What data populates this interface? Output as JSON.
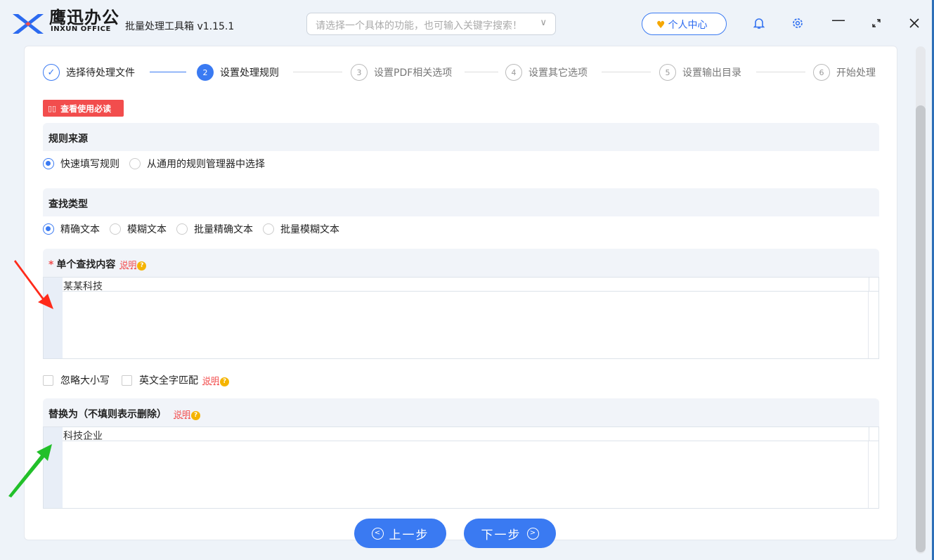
{
  "app": {
    "brand_cn": "鹰迅办公",
    "brand_en": "INXUN OFFICE",
    "title": "批量处理工具箱 v1.15.1"
  },
  "search": {
    "placeholder": "请选择一个具体的功能，也可输入关键字搜索！"
  },
  "header": {
    "personal_center": "个人中心"
  },
  "steps": [
    {
      "num": "✓",
      "label": "选择待处理文件",
      "state": "done"
    },
    {
      "num": "2",
      "label": "设置处理规则",
      "state": "active"
    },
    {
      "num": "3",
      "label": "设置PDF相关选项",
      "state": "todo"
    },
    {
      "num": "4",
      "label": "设置其它选项",
      "state": "todo"
    },
    {
      "num": "5",
      "label": "设置输出目录",
      "state": "todo"
    },
    {
      "num": "6",
      "label": "开始处理",
      "state": "todo"
    }
  ],
  "readme_button": "查看使用必读",
  "rule_source": {
    "title": "规则来源",
    "options": [
      "快速填写规则",
      "从通用的规则管理器中选择"
    ],
    "selected": 0
  },
  "search_type": {
    "title": "查找类型",
    "options": [
      "精确文本",
      "模糊文本",
      "批量精确文本",
      "批量模糊文本"
    ],
    "selected": 0
  },
  "find_content": {
    "title": "单个查找内容",
    "explain": "说明",
    "value": "某某科技"
  },
  "options_checks": {
    "ignore_case": "忽略大小写",
    "whole_word": "英文全字匹配",
    "explain": "说明"
  },
  "replace_with": {
    "title": "替换为（不填则表示删除）",
    "explain": "说明",
    "value": "科技企业"
  },
  "nav": {
    "prev": "上一步",
    "next": "下一步"
  },
  "colors": {
    "accent": "#3a7af2",
    "danger": "#f24d4d",
    "red_arrow": "#ff2a1a",
    "green_arrow": "#22c02a"
  }
}
